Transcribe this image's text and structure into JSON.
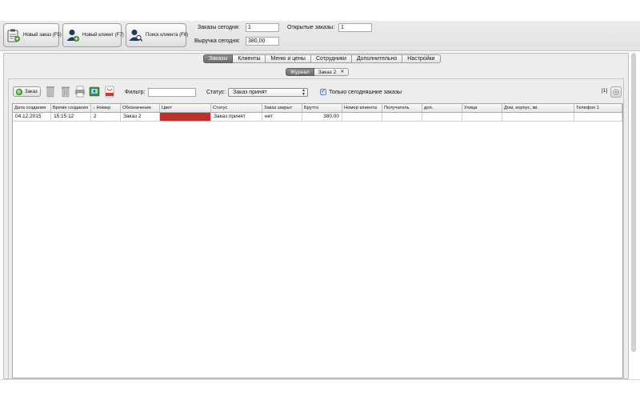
{
  "toolbar": {
    "new_order_label": "Новый заказ (F5)",
    "new_client_label": "Новый клиент (F7)",
    "search_client_label": "Поиск клиента (F8)"
  },
  "stats": {
    "orders_today_label": "Заказы сегодня:",
    "orders_today_value": "1",
    "open_orders_label": "Открытые заказы:",
    "open_orders_value": "1",
    "revenue_today_label": "Выручка сегодня:",
    "revenue_today_value": "380,00"
  },
  "tabs": [
    "Заказы",
    "Клиенты",
    "Меню и цены",
    "Сотрудники",
    "Дополнительно",
    "Настройки"
  ],
  "subtabs": {
    "journal": "Журнал",
    "order2": "Заказ 2"
  },
  "filters": {
    "order_button": "Заказ",
    "filter_label": "Фильтр:",
    "filter_value": "",
    "status_label": "Статус:",
    "status_value": "Заказ принят",
    "today_only_label": "Только сегодняшние заказы",
    "today_only_checked": true,
    "count_label": "[1]"
  },
  "table": {
    "columns": [
      "Дата создания",
      "Время создания",
      "↓ Номер",
      "Обозначение",
      "Цвет",
      "Статус",
      "Заказ закрыт",
      "Брутто",
      "Номер клиента",
      "Получатель",
      "доп.",
      "Улица",
      "Дом, корпус, кв.",
      "Телефон 1"
    ],
    "rows": [
      {
        "date": "04.12.2015",
        "time": "15:15:12",
        "number": "2",
        "designation": "Заказ 2",
        "color": "#c0302a",
        "status": "Заказ принят",
        "closed": "нет",
        "gross": "380,00",
        "client_number": "",
        "recipient": "",
        "extra": "",
        "street": "",
        "house": "",
        "phone": ""
      }
    ]
  },
  "colors": {
    "row_color_swatch": "#c0302a",
    "active_tab": "#7a7a7a"
  }
}
